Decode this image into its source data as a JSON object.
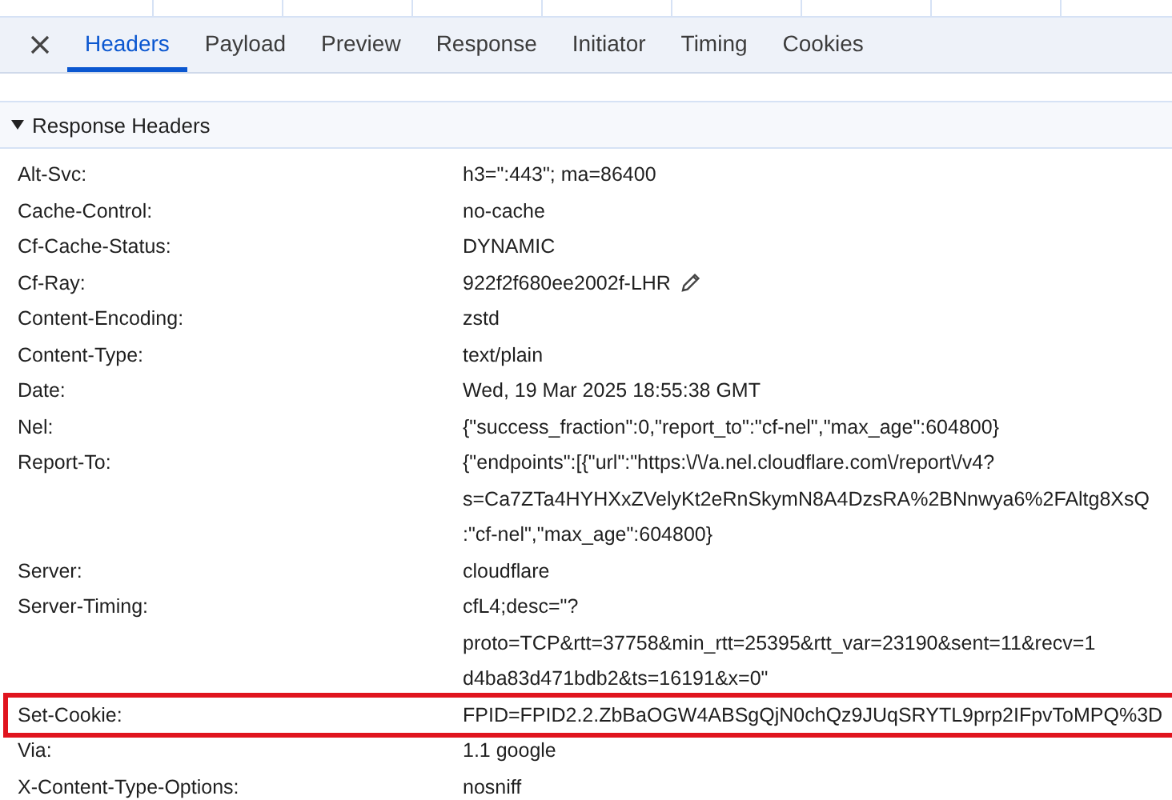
{
  "tabs": [
    {
      "label": "Headers",
      "selected": true
    },
    {
      "label": "Payload",
      "selected": false
    },
    {
      "label": "Preview",
      "selected": false
    },
    {
      "label": "Response",
      "selected": false
    },
    {
      "label": "Initiator",
      "selected": false
    },
    {
      "label": "Timing",
      "selected": false
    },
    {
      "label": "Cookies",
      "selected": false
    }
  ],
  "section": {
    "title": "Response Headers",
    "expanded": true
  },
  "headers": [
    {
      "name": "Alt-Svc:",
      "lines": [
        "h3=\":443\"; ma=86400"
      ],
      "editable": false,
      "highlighted": false
    },
    {
      "name": "Cache-Control:",
      "lines": [
        "no-cache"
      ],
      "editable": false,
      "highlighted": false
    },
    {
      "name": "Cf-Cache-Status:",
      "lines": [
        "DYNAMIC"
      ],
      "editable": false,
      "highlighted": false
    },
    {
      "name": "Cf-Ray:",
      "lines": [
        "922f2f680ee2002f-LHR"
      ],
      "editable": true,
      "highlighted": false
    },
    {
      "name": "Content-Encoding:",
      "lines": [
        "zstd"
      ],
      "editable": false,
      "highlighted": false
    },
    {
      "name": "Content-Type:",
      "lines": [
        "text/plain"
      ],
      "editable": false,
      "highlighted": false
    },
    {
      "name": "Date:",
      "lines": [
        "Wed, 19 Mar 2025 18:55:38 GMT"
      ],
      "editable": false,
      "highlighted": false
    },
    {
      "name": "Nel:",
      "lines": [
        "{\"success_fraction\":0,\"report_to\":\"cf-nel\",\"max_age\":604800}"
      ],
      "editable": false,
      "highlighted": false
    },
    {
      "name": "Report-To:",
      "lines": [
        "{\"endpoints\":[{\"url\":\"https:\\/\\/a.nel.cloudflare.com\\/report\\/v4?",
        "s=Ca7ZTa4HYHXxZVelyKt2eRnSkymN8A4DzsRA%2BNnwya6%2FAltg8XsQ",
        ":\"cf-nel\",\"max_age\":604800}"
      ],
      "editable": false,
      "highlighted": false
    },
    {
      "name": "Server:",
      "lines": [
        "cloudflare"
      ],
      "editable": false,
      "highlighted": false
    },
    {
      "name": "Server-Timing:",
      "lines": [
        "cfL4;desc=\"?",
        "proto=TCP&rtt=37758&min_rtt=25395&rtt_var=23190&sent=11&recv=1",
        "d4ba83d471bdb2&ts=16191&x=0\""
      ],
      "editable": false,
      "highlighted": false
    },
    {
      "name": "Set-Cookie:",
      "lines": [
        "FPID=FPID2.2.ZbBaOGW4ABSgQjN0chQz9JUqSRYTL9prp2IFpvToMPQ%3D"
      ],
      "editable": false,
      "highlighted": true
    },
    {
      "name": "Via:",
      "lines": [
        "1.1 google"
      ],
      "editable": false,
      "highlighted": false
    },
    {
      "name": "X-Content-Type-Options:",
      "lines": [
        "nosniff"
      ],
      "editable": false,
      "highlighted": false
    }
  ]
}
